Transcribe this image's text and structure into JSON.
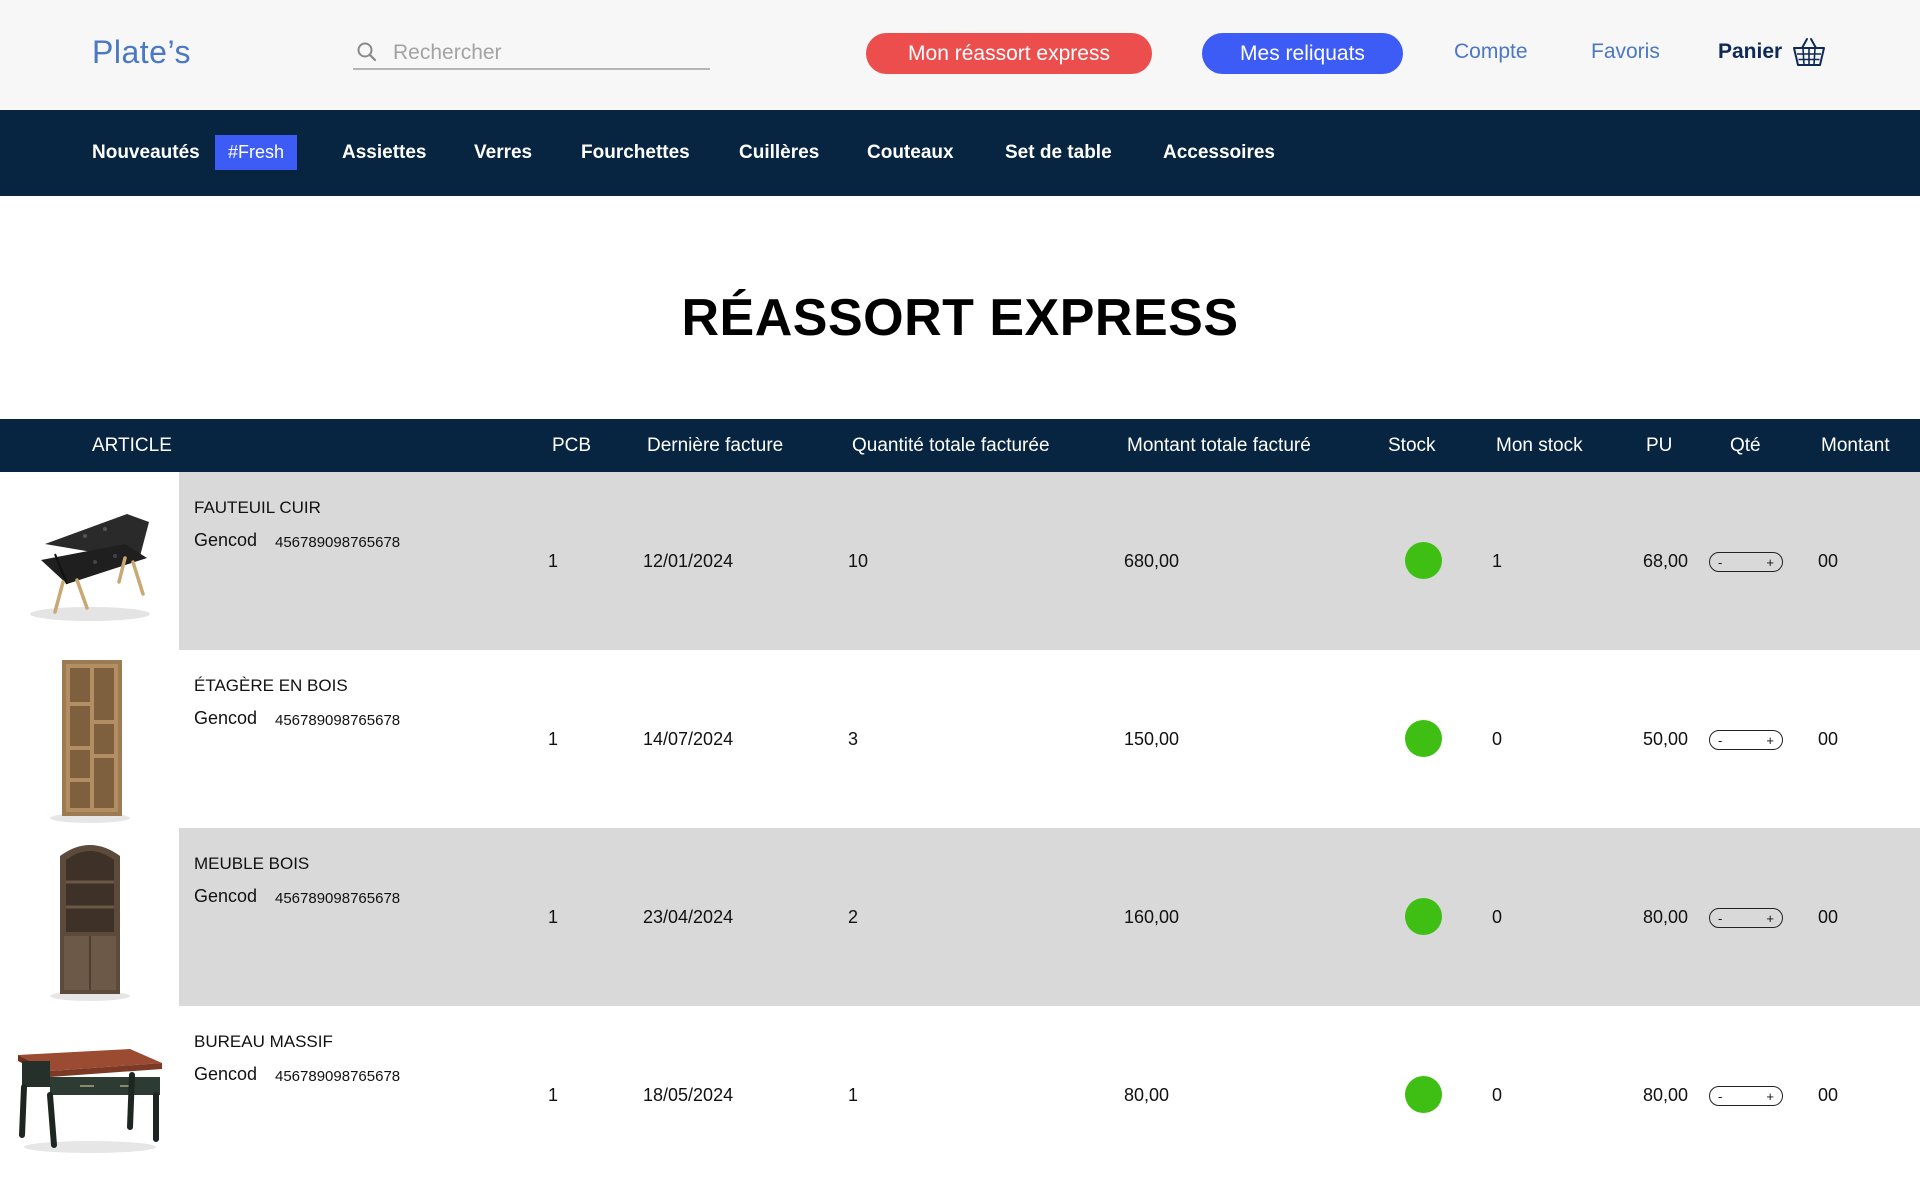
{
  "header": {
    "logo": "Plate’s",
    "search_placeholder": "Rechercher",
    "reassort_button": "Mon réassort express",
    "reliquats_button": "Mes reliquats",
    "account_link": "Compte",
    "favorites_link": "Favoris",
    "cart_label": "Panier",
    "accent_red": "#ec4e4e",
    "accent_blue": "#3d5cf5"
  },
  "nav": {
    "items": [
      "Nouveautés",
      "Assiettes",
      "Verres",
      "Fourchettes",
      "Cuillères",
      "Couteaux",
      "Set de table",
      "Accessoires"
    ],
    "badge": "#Fresh"
  },
  "page": {
    "title": "RÉASSORT EXPRESS"
  },
  "table": {
    "headers": [
      "ARTICLE",
      "PCB",
      "Dernière facture",
      "Quantité totale facturée",
      "Montant totale facturé",
      "Stock",
      "Mon stock",
      "PU",
      "Qté",
      "Montant"
    ],
    "gencod_label": "Gencod",
    "stock_color": "#3fbf14",
    "rows": [
      {
        "name": "FAUTEUIL CUIR",
        "gencod": "456789098765678",
        "pcb": "1",
        "last_invoice": "12/01/2024",
        "qty_total": "10",
        "amount_total": "680,00",
        "stock": "in-stock",
        "my_stock": "1",
        "pu": "68,00",
        "qte_minus": "-",
        "qte_plus": "+",
        "montant": "00",
        "image_icon": "armchair-image"
      },
      {
        "name": "ÉTAGÈRE EN BOIS",
        "gencod": "456789098765678",
        "pcb": "1",
        "last_invoice": "14/07/2024",
        "qty_total": "3",
        "amount_total": "150,00",
        "stock": "in-stock",
        "my_stock": "0",
        "pu": "50,00",
        "qte_minus": "-",
        "qte_plus": "+",
        "montant": "00",
        "image_icon": "bookshelf-image"
      },
      {
        "name": "MEUBLE BOIS",
        "gencod": "456789098765678",
        "pcb": "1",
        "last_invoice": "23/04/2024",
        "qty_total": "2",
        "amount_total": "160,00",
        "stock": "in-stock",
        "my_stock": "0",
        "pu": "80,00",
        "qte_minus": "-",
        "qte_plus": "+",
        "montant": "00",
        "image_icon": "cabinet-image"
      },
      {
        "name": "BUREAU MASSIF",
        "gencod": "456789098765678",
        "pcb": "1",
        "last_invoice": "18/05/2024",
        "qty_total": "1",
        "amount_total": "80,00",
        "stock": "in-stock",
        "my_stock": "0",
        "pu": "80,00",
        "qte_minus": "-",
        "qte_plus": "+",
        "montant": "00",
        "image_icon": "desk-image"
      }
    ]
  }
}
